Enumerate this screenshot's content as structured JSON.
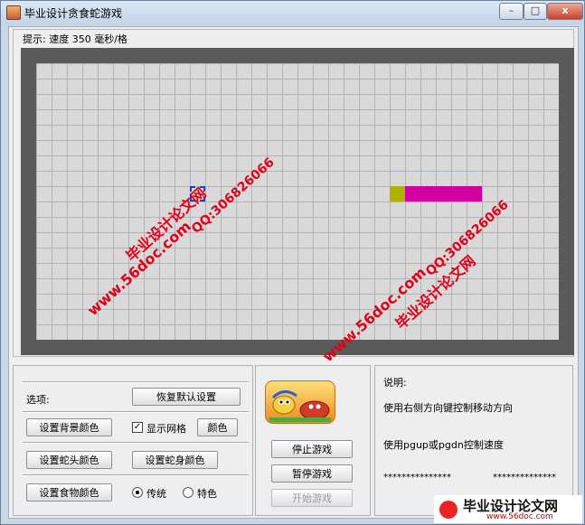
{
  "window": {
    "title": "毕业设计贪食蛇游戏",
    "minimize": "–",
    "maximize": "□",
    "close": "x"
  },
  "hint": {
    "text": "提示:  速度 350  毫秒/格"
  },
  "board": {
    "colors": {
      "border": "#5a5a5a",
      "background": "#d9d9d9",
      "grid": "#b3b3b3",
      "snake_head": "#b0b000",
      "snake_body": "#d000a0",
      "food": "#1f3fcf"
    },
    "snake_segments": 6,
    "show_grid": true
  },
  "options": {
    "label": "选项:",
    "restore_defaults": "恢复默认设置",
    "set_bg_color": "设置背景颜色",
    "show_grid_label": "显示网格",
    "show_grid_checked": true,
    "color_button": "颜色",
    "set_head_color": "设置蛇头颜色",
    "set_body_color": "设置蛇身颜色",
    "set_food_color": "设置食物颜色",
    "mode_traditional": "传统",
    "mode_special": "特色",
    "selected_mode": "传统"
  },
  "controls": {
    "stop": "停止游戏",
    "pause": "暂停游戏",
    "start": "开始游戏"
  },
  "help": {
    "title": "说明:",
    "line1": "使用右侧方向键控制移动方向",
    "line2": "使用pgup或pgdn控制速度",
    "stars_left": "***************",
    "stars_right": "**************"
  },
  "watermarks": {
    "site": "www.56doc.com",
    "name": "毕业设计论文网",
    "qq": "QQ:306826066",
    "logo_text": "毕业设计论文网",
    "logo_site": "www.56doc.com"
  }
}
